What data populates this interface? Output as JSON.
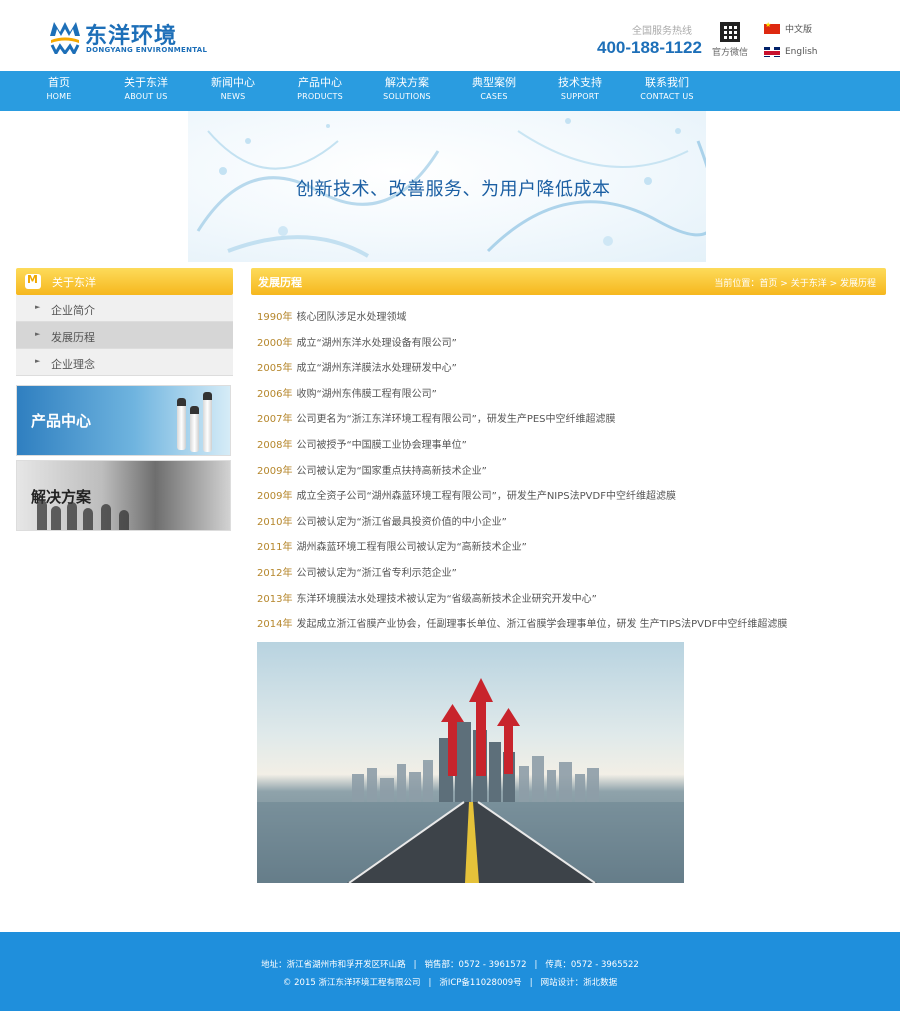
{
  "header": {
    "logo_cn": "东洋环境",
    "logo_en": "DONGYANG ENVIRONMENTAL",
    "hotline_label": "全国服务热线",
    "hotline": "400-188-1122",
    "wechat_label": "官方微信",
    "lang_cn": "中文版",
    "lang_en": "English"
  },
  "nav": [
    {
      "zh": "首页",
      "en": "HOME"
    },
    {
      "zh": "关于东洋",
      "en": "ABOUT US"
    },
    {
      "zh": "新闻中心",
      "en": "NEWS"
    },
    {
      "zh": "产品中心",
      "en": "PRODUCTS"
    },
    {
      "zh": "解决方案",
      "en": "SOLUTIONS"
    },
    {
      "zh": "典型案例",
      "en": "CASES"
    },
    {
      "zh": "技术支持",
      "en": "SUPPORT"
    },
    {
      "zh": "联系我们",
      "en": "CONTACT US"
    }
  ],
  "banner": {
    "text": "创新技术、改善服务、为用户降低成本"
  },
  "sidebar": {
    "title": "关于东洋",
    "items": [
      "企业简介",
      "发展历程",
      "企业理念"
    ],
    "active_index": 1,
    "promo1": "产品中心",
    "promo2": "解决方案"
  },
  "content": {
    "title": "发展历程",
    "crumb_prefix": "当前位置：",
    "crumb_home": "首页",
    "crumb_sep1": " > ",
    "crumb_mid": "关于东洋",
    "crumb_sep2": " > ",
    "crumb_last": "发展历程",
    "timeline": [
      {
        "year": "1990年",
        "text": "核心团队涉足水处理领域"
      },
      {
        "year": "2000年",
        "text": "成立“湖州东洋水处理设备有限公司”"
      },
      {
        "year": "2005年",
        "text": "成立“湖州东洋膜法水处理研发中心”"
      },
      {
        "year": "2006年",
        "text": "收购“湖州东伟膜工程有限公司”"
      },
      {
        "year": "2007年",
        "text": "公司更名为“浙江东洋环境工程有限公司”，研发生产PES中空纤维超滤膜"
      },
      {
        "year": "2008年",
        "text": "公司被授予“中国膜工业协会理事单位”"
      },
      {
        "year": "2009年",
        "text": "公司被认定为“国家重点扶持高新技术企业”"
      },
      {
        "year": "2009年",
        "text": "成立全资子公司“湖州森蓝环境工程有限公司”，研发生产NIPS法PVDF中空纤维超滤膜"
      },
      {
        "year": "2010年",
        "text": "公司被认定为“浙江省最具投资价值的中小企业”"
      },
      {
        "year": "2011年",
        "text": "湖州森蓝环境工程有限公司被认定为“高新技术企业”"
      },
      {
        "year": "2012年",
        "text": "公司被认定为“浙江省专利示范企业”"
      },
      {
        "year": "2013年",
        "text": "东洋环境膜法水处理技术被认定为“省级高新技术企业研究开发中心”"
      },
      {
        "year": "2014年",
        "text": "发起成立浙江省膜产业协会，任副理事长单位、浙江省膜学会理事单位，研发 生产TIPS法PVDF中空纤维超滤膜"
      }
    ]
  },
  "footer": {
    "address": "地址：浙江省湖州市和孚开发区环山路",
    "sep": "|",
    "sales": "销售部：0572 - 3961572",
    "fax": "传真：0572 - 3965522",
    "copyright": "© 2015 浙江东洋环境工程有限公司",
    "icp": "浙ICP备11028009号",
    "design": "网站设计：浙北数据"
  },
  "colors": {
    "brand_blue": "#1d6fb8",
    "nav_blue": "#2a9ce0",
    "footer_blue": "#1f8fdc",
    "accent_yellow": "#f6b71e",
    "year_gold": "#b5862b"
  }
}
